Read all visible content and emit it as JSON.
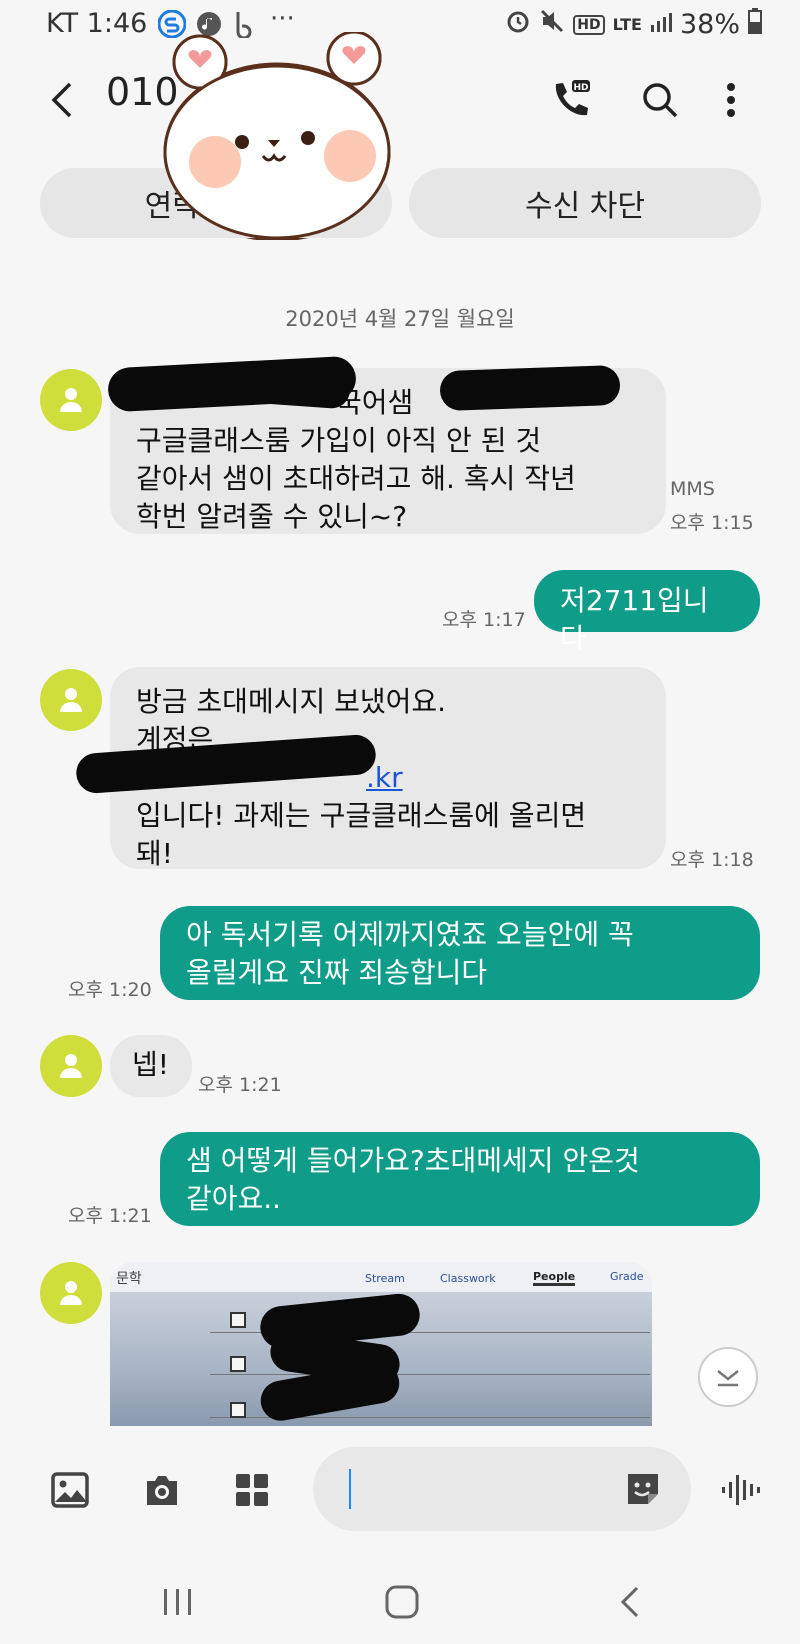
{
  "status_bar": {
    "carrier_time": "KT 1:46",
    "network": "LTE",
    "battery": "38%"
  },
  "header": {
    "contact_partial": "010",
    "back_icon": "back-arrow-icon",
    "call_icon": "hd-call-icon",
    "search_icon": "search-icon",
    "more_icon": "more-vertical-icon"
  },
  "actions": {
    "contact_button": "연락처",
    "block_button": "수신 차단"
  },
  "date_separator": "2020년 4월 27일 월요일",
  "messages": [
    {
      "dir": "in",
      "line1_visible": "국어샘",
      "text": "구글클래스룸 가입이 아직 안 된 것\n같아서 샘이 초대하려고 해. 혹시 작년\n학번 알려줄 수 있니~?",
      "tag": "MMS",
      "time": "오후 1:15"
    },
    {
      "dir": "out",
      "text": "저2711입니다",
      "time": "오후 1:17"
    },
    {
      "dir": "in",
      "text_top": "방금 초대메시지 보냈어요.\n계정은",
      "link_fragment": ".kr",
      "text_bottom": "입니다! 과제는 구글클래스룸에 올리면\n돼!",
      "time": "오후 1:18"
    },
    {
      "dir": "out",
      "text": "아 독서기록 어제까지였죠 오늘안에 꼭\n올릴게요 진짜 죄송합니다",
      "time": "오후 1:20"
    },
    {
      "dir": "in",
      "text": "넵!",
      "time": "오후 1:21"
    },
    {
      "dir": "out",
      "text": "샘 어떻게 들어가요?초대메세지 안온것\n같아요..",
      "time": "오후 1:21"
    },
    {
      "dir": "in",
      "image_texts": {
        "label": "문학",
        "tab1": "Stream",
        "tab2": "Classwork",
        "tab3": "People",
        "tab4": "Grade"
      }
    }
  ],
  "input": {
    "placeholder": "",
    "gallery_icon": "gallery-icon",
    "camera_icon": "camera-icon",
    "apps_icon": "apps-grid-icon",
    "sticker_icon": "sticker-icon",
    "voice_icon": "voice-wave-icon",
    "scroll_down_icon": "scroll-down-icon"
  },
  "colors": {
    "outgoing_bubble": "#0f9d8a",
    "incoming_bubble": "#e8e8e8",
    "avatar": "#cfde3a",
    "background": "#f6f6f6"
  }
}
